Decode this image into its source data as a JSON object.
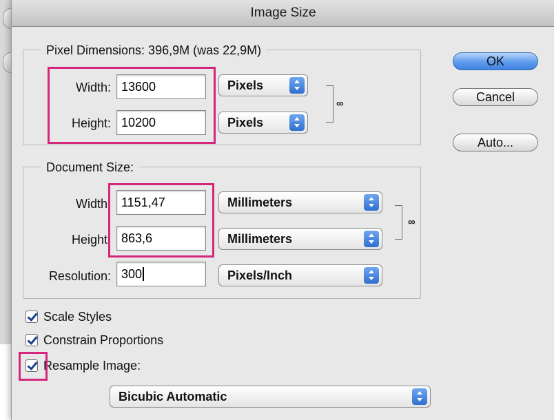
{
  "window": {
    "title": "Image Size"
  },
  "pixel_dimensions": {
    "legend": "Pixel Dimensions:  396,9M (was 22,9M)",
    "width_label": "Width:",
    "width_value": "13600",
    "width_unit": "Pixels",
    "height_label": "Height:",
    "height_value": "10200",
    "height_unit": "Pixels"
  },
  "document_size": {
    "legend": "Document Size:",
    "width_label": "Width:",
    "width_value": "1151,47",
    "width_unit": "Millimeters",
    "height_label": "Height:",
    "height_value": "863,6",
    "height_unit": "Millimeters",
    "resolution_label": "Resolution:",
    "resolution_value": "300",
    "resolution_unit": "Pixels/Inch"
  },
  "buttons": {
    "ok": "OK",
    "cancel": "Cancel",
    "auto": "Auto..."
  },
  "options": {
    "scale_styles": "Scale Styles",
    "constrain_proportions": "Constrain Proportions",
    "resample_image": "Resample Image:",
    "resample_method": "Bicubic Automatic"
  },
  "colors": {
    "highlight": "#d4267c",
    "primary_button": "#5e9bec",
    "dialog_bg": "#e8e8e8"
  },
  "icons": {
    "link": "chain-link-icon",
    "checkmark": "checkmark-icon",
    "popup_arrows": "up-down-arrows-icon"
  }
}
